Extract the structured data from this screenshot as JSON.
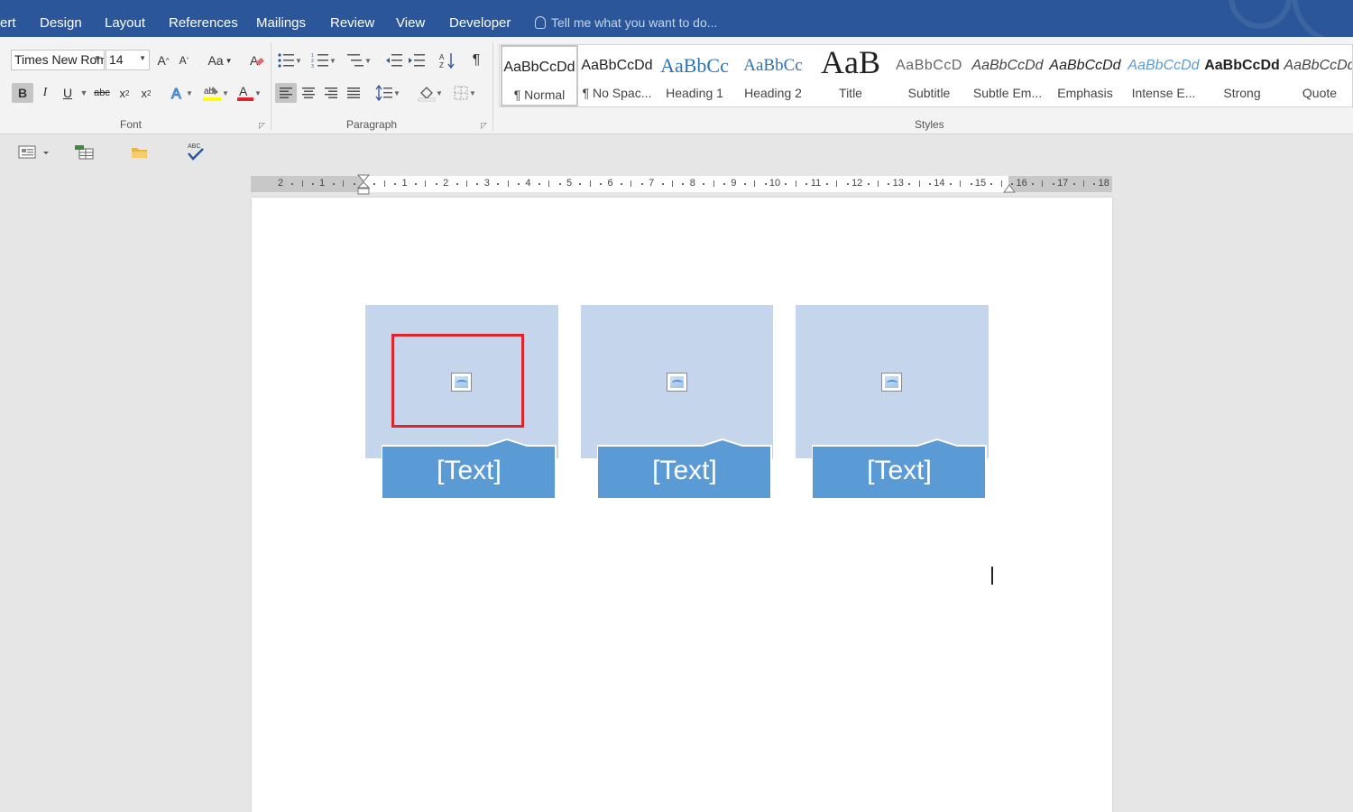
{
  "menu": {
    "tabs": [
      "ert",
      "Design",
      "Layout",
      "References",
      "Mailings",
      "Review",
      "View",
      "Developer"
    ],
    "tell_me": "Tell me what you want to do..."
  },
  "font_group": {
    "font_name": "Times New Roman",
    "font_size": "14",
    "label": "Font"
  },
  "paragraph_group": {
    "label": "Paragraph"
  },
  "styles_group": {
    "label": "Styles",
    "items": [
      {
        "sample": "AaBbCcDd",
        "name": "¶ Normal"
      },
      {
        "sample": "AaBbCcDd",
        "name": "¶ No Spac..."
      },
      {
        "sample": "AaBbCc",
        "name": "Heading 1"
      },
      {
        "sample": "AaBbCc",
        "name": "Heading 2"
      },
      {
        "sample": "AaB",
        "name": "Title"
      },
      {
        "sample": "AaBbCcD",
        "name": "Subtitle"
      },
      {
        "sample": "AaBbCcDd",
        "name": "Subtle Em..."
      },
      {
        "sample": "AaBbCcDd",
        "name": "Emphasis"
      },
      {
        "sample": "AaBbCcDd",
        "name": "Intense E..."
      },
      {
        "sample": "AaBbCcDd",
        "name": "Strong"
      },
      {
        "sample": "AaBbCcDd",
        "name": "Quote"
      }
    ]
  },
  "ruler": {
    "left_labels": [
      "2",
      "1"
    ],
    "right_labels": [
      "1",
      "2",
      "3",
      "4",
      "5",
      "6",
      "7",
      "8",
      "9",
      "10",
      "11",
      "12",
      "13",
      "14",
      "15",
      "16",
      "17",
      "18"
    ]
  },
  "smartart": {
    "labels": [
      "[Text]",
      "[Text]",
      "[Text]"
    ]
  },
  "colors": {
    "title_bar": "#2b579a",
    "panel": "#c5d5ec",
    "label_box": "#5b9bd5",
    "selection": "#e0242b"
  }
}
